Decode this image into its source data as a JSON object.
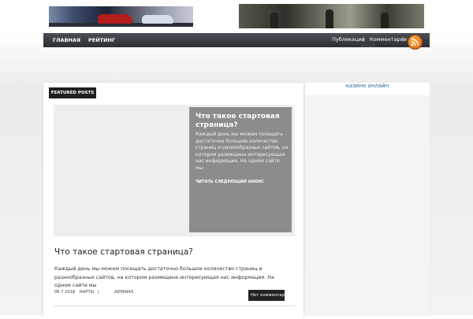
{
  "nav": {
    "items": [
      {
        "label": "ГЛАВНАЯ"
      },
      {
        "label": "РЕЙТИНГ"
      }
    ],
    "right_links": {
      "posts": "Публикации",
      "comments": "Комментарии",
      "email": "Email",
      "separator": "|"
    }
  },
  "sidebar": {
    "link": "казино онлайн"
  },
  "featured": {
    "tab_label": "FEATURED POSTS",
    "title": "Что такое стартовая страница?",
    "excerpt": "Каждый день мы можем посещать достаточно большое количество страниц и разнообразных сайтов, на котором размещена интересующая нас информация. На одном сайте мы",
    "read_more": "ЧИТАТЬ СЛЕДУЮЩИЙ АНОНС"
  },
  "post": {
    "title": "Что такое стартовая страница?",
    "excerpt": "Каждый день мы можем посещать достаточно большое количество страниц и разнообразных сайтов, на котором размещена интересующая нас информация. На одном сайте мы",
    "date": "06.7.2015",
    "category": "КАРТЫ",
    "author": "ADMINAS",
    "separator": "|",
    "comments": "Нет комментариев"
  },
  "colors": {
    "navbar": "#34383e",
    "link": "#2a6496",
    "featured_caption": "#8c8c8c",
    "rss": "#e8741a"
  },
  "icons": {
    "rss": "rss-icon"
  }
}
